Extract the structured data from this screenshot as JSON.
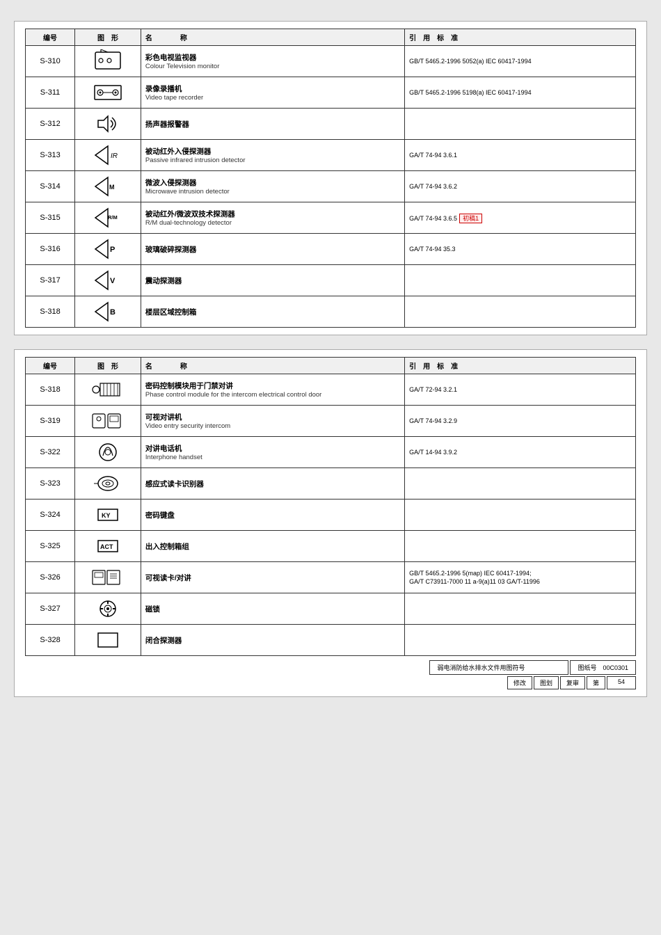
{
  "section1": {
    "headers": [
      "编号",
      "图 形",
      "名　　称",
      "引用标准"
    ],
    "rows": [
      {
        "num": "S-310",
        "symbol_type": "tv",
        "name_cn": "彩色电视监视器",
        "name_en": "Colour Television monitor",
        "std": "GB/T 5465.2-1996 5052(a) IEC 60417-1994"
      },
      {
        "num": "S-311",
        "symbol_type": "vtr",
        "name_cn": "录像录播机",
        "name_en": "Video tape recorder",
        "std": "GB/T 5465.2-1996 5198(a) IEC 60417-1994"
      },
      {
        "num": "S-312",
        "symbol_type": "speaker",
        "name_cn": "扬声器报警器",
        "name_en": "",
        "std": ""
      },
      {
        "num": "S-313",
        "symbol_type": "ir",
        "name_cn": "被动红外入侵探测器",
        "name_en": "Passive infrared intrusion detector",
        "std": "GA/T 74-94 3.6.1"
      },
      {
        "num": "S-314",
        "symbol_type": "mw",
        "name_cn": "微波入侵探测器",
        "name_en": "Microwave intrusion detector",
        "std": "GA/T 74-94 3.6.2"
      },
      {
        "num": "S-315",
        "symbol_type": "rm",
        "name_cn": "被动红外/微波双技术探测器",
        "name_en": "R/M dual-technology detector",
        "std": "GA/T 74-94 3.6.5",
        "note": "初稿1"
      },
      {
        "num": "S-316",
        "symbol_type": "p",
        "name_cn": "玻璃破碎探测器",
        "name_en": "",
        "std": "GA/T 74-94 35.3"
      },
      {
        "num": "S-317",
        "symbol_type": "v",
        "name_cn": "震动探测器",
        "name_en": "",
        "std": ""
      },
      {
        "num": "S-318",
        "symbol_type": "b",
        "name_cn": "楼层区域控制箱",
        "name_en": "",
        "std": ""
      }
    ]
  },
  "section2": {
    "headers": [
      "编号",
      "图 形",
      "名　　称",
      "引用标准"
    ],
    "rows": [
      {
        "num": "S-318",
        "symbol_type": "control_module",
        "name_cn": "密码控制模块用于门禁对讲",
        "name_en": "Phase control module for the intercom electrical control door",
        "std": "GA/T 72-94 3.2.1"
      },
      {
        "num": "S-319",
        "symbol_type": "video_intercom",
        "name_cn": "可视对讲机",
        "name_en": "Video entry security intercom",
        "std": "GA/T 74-94 3.2.9"
      },
      {
        "num": "S-322",
        "symbol_type": "interphone",
        "name_cn": "对讲电话机",
        "name_en": "Interphone handset",
        "std": "GA/T 14-94 3.9.2"
      },
      {
        "num": "S-323",
        "symbol_type": "reader",
        "name_cn": "感应式读卡识别器",
        "name_en": "",
        "std": ""
      },
      {
        "num": "S-324",
        "symbol_type": "ky",
        "name_cn": "密码键盘",
        "name_en": "",
        "std": ""
      },
      {
        "num": "S-325",
        "symbol_type": "act",
        "name_cn": "出入控制箱组",
        "name_en": "",
        "std": ""
      },
      {
        "num": "S-326",
        "symbol_type": "card_reader",
        "name_cn": "可视读卡/对讲",
        "name_en": "",
        "std": "GB/T 5465.2-1996 5(map) IEC 60417-1994;\nGA/T C73911-7000 11 a-9(a)11 03 GA/T-11996"
      },
      {
        "num": "S-327",
        "symbol_type": "gear_lock",
        "name_cn": "磁锁",
        "name_en": "",
        "std": ""
      },
      {
        "num": "S-328",
        "symbol_type": "door_contact",
        "name_cn": "闭合探测器",
        "name_en": "",
        "std": ""
      }
    ],
    "footer": {
      "doc_ref": "弱电消防给水排水文件用图符号",
      "doc_num": "00C0301",
      "revision": "修",
      "draw": "图划",
      "review": "复审",
      "page": "第",
      "page_num": "54"
    }
  }
}
